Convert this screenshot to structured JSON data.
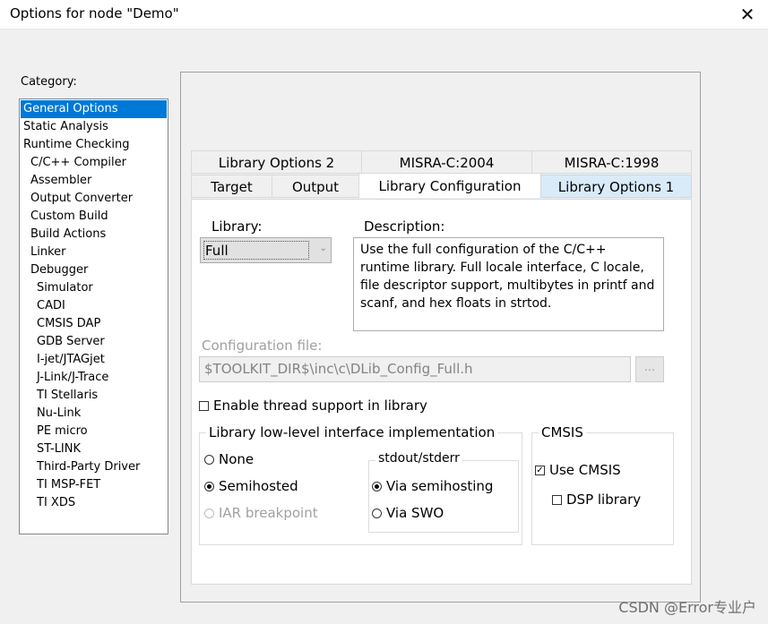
{
  "window": {
    "title": "Options for node \"Demo\"",
    "close_glyph": "✕"
  },
  "category": {
    "label": "Category:",
    "items": [
      "General Options",
      "Static Analysis",
      "Runtime Checking",
      "C/C++ Compiler",
      "Assembler",
      "Output Converter",
      "Custom Build",
      "Build Actions",
      "Linker",
      "Debugger",
      "Simulator",
      "CADI",
      "CMSIS DAP",
      "GDB Server",
      "I-jet/JTAGjet",
      "J-Link/J-Trace",
      "TI Stellaris",
      "Nu-Link",
      "PE micro",
      "ST-LINK",
      "Third-Party Driver",
      "TI MSP-FET",
      "TI XDS"
    ],
    "selected": "General Options"
  },
  "tabs": {
    "row1": [
      "Library Options 2",
      "MISRA-C:2004",
      "MISRA-C:1998"
    ],
    "row2": [
      "Target",
      "Output",
      "Library Configuration",
      "Library Options 1"
    ],
    "active": "Library Configuration"
  },
  "library": {
    "label": "Library:",
    "value": "Full",
    "dropdown_glyph": "⌄"
  },
  "description": {
    "label": "Description:",
    "text": "Use the full configuration of the C/C++ runtime library. Full locale interface, C locale, file descriptor support, multibytes in printf and scanf, and hex floats in strtod."
  },
  "config_file": {
    "label": "Configuration file:",
    "value": "$TOOLKIT_DIR$\\inc\\c\\DLib_Config_Full.h",
    "browse_label": "..."
  },
  "thread_support": {
    "label": "Enable thread support in library",
    "checked": false
  },
  "low_level": {
    "title": "Library low-level interface implementation",
    "options": [
      "None",
      "Semihosted",
      "IAR breakpoint"
    ],
    "selected": "Semihosted"
  },
  "stdout": {
    "title": "stdout/stderr",
    "options": [
      "Via semihosting",
      "Via SWO"
    ],
    "selected": "Via semihosting"
  },
  "cmsis": {
    "title": "CMSIS",
    "use_cmsis": {
      "label": "Use CMSIS",
      "checked": true
    },
    "dsp_library": {
      "label": "DSP library",
      "checked": false
    }
  },
  "watermark": "CSDN @Error专业户"
}
